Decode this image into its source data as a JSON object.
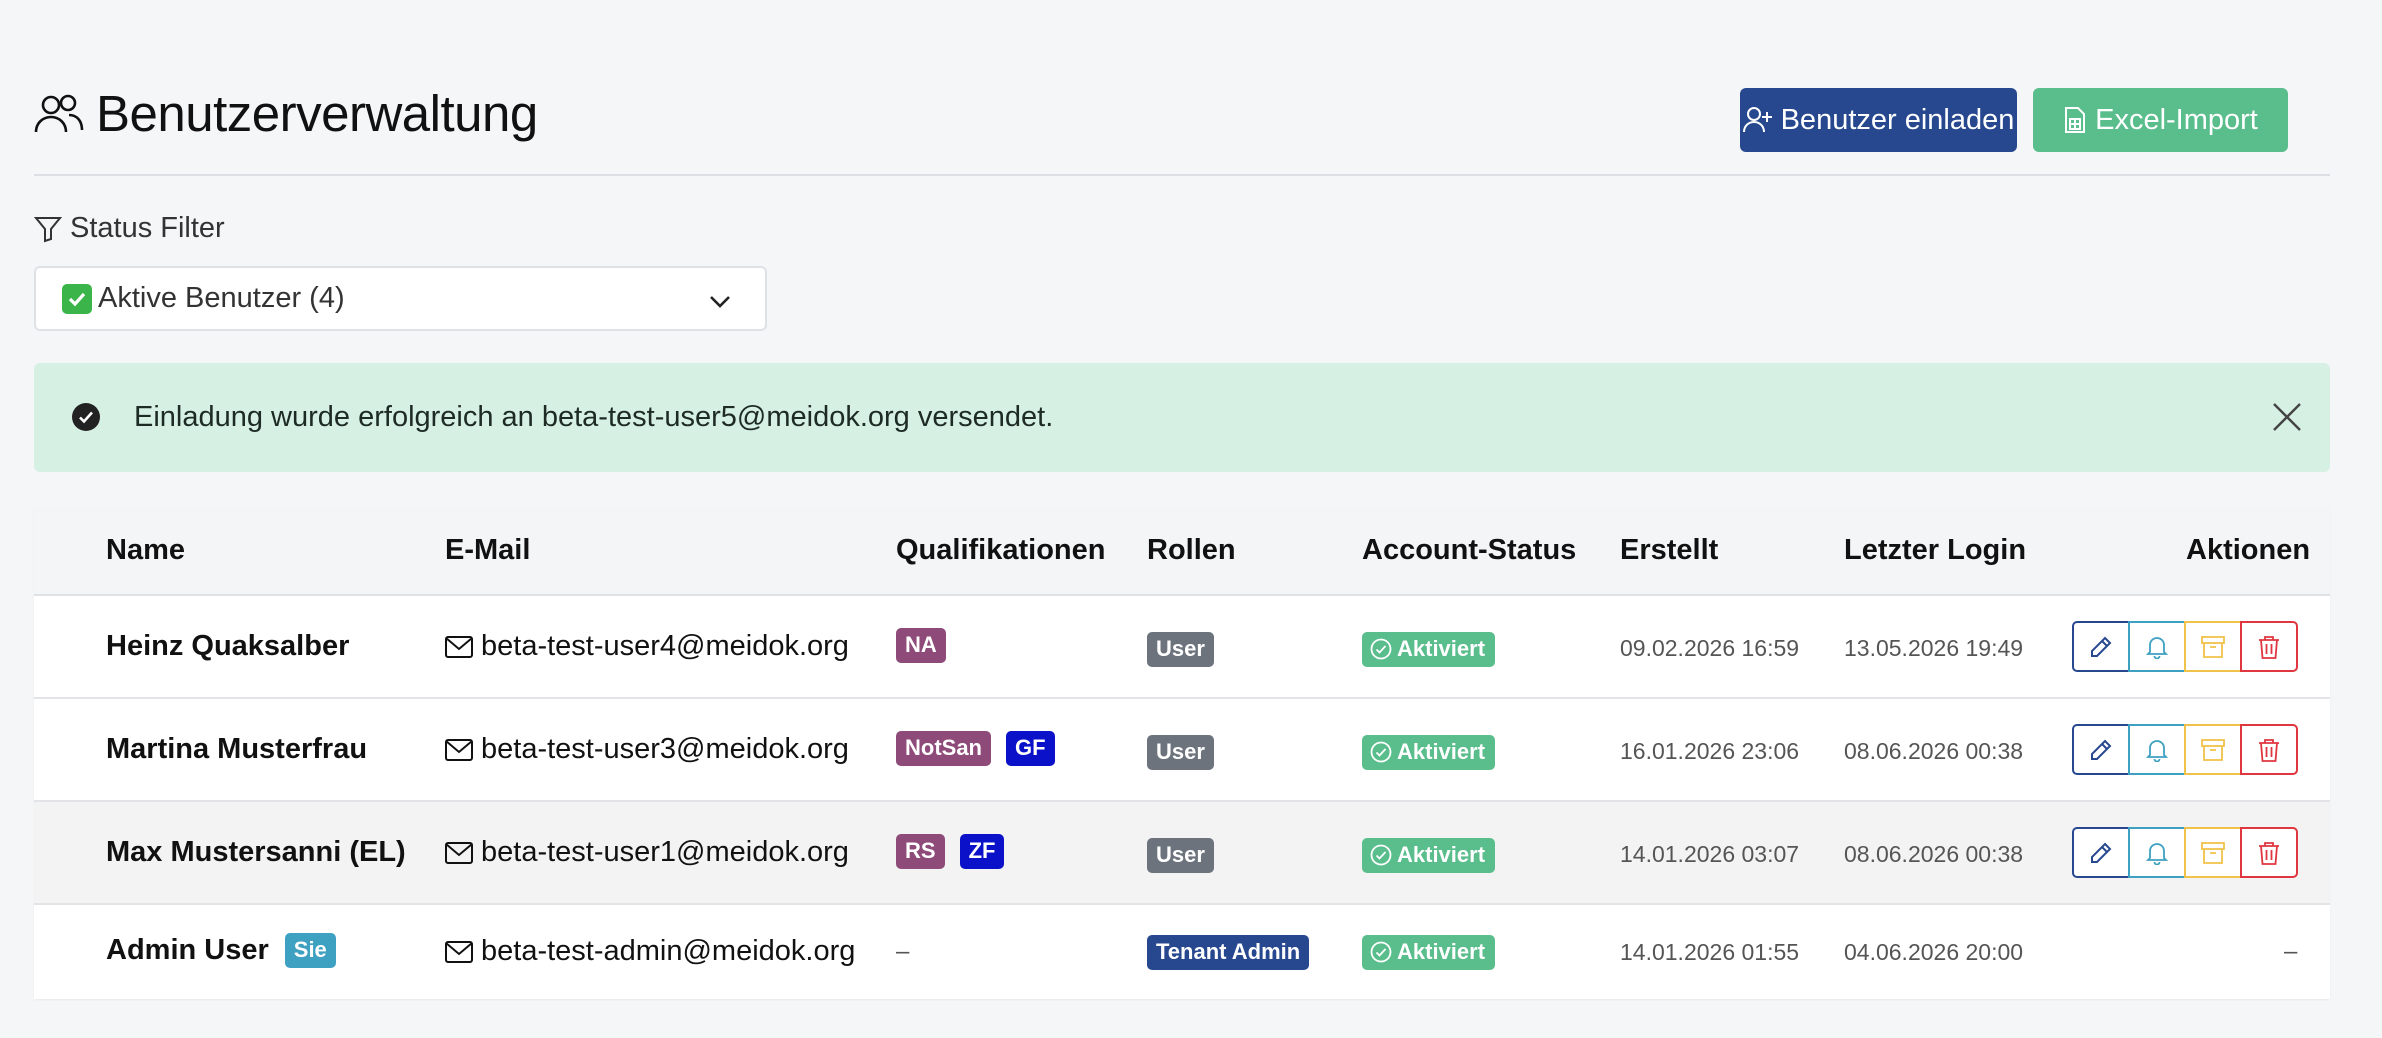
{
  "header": {
    "title": "Benutzerverwaltung",
    "invite_label": "Benutzer einladen",
    "import_label": "Excel-Import"
  },
  "filter": {
    "label": "Status Filter",
    "selected": "Aktive Benutzer (4)"
  },
  "alert": {
    "message": "Einladung wurde erfolgreich an beta-test-user5@meidok.org versendet."
  },
  "table": {
    "columns": [
      "Name",
      "E-Mail",
      "Qualifikationen",
      "Rollen",
      "Account-Status",
      "Erstellt",
      "Letzter Login",
      "Aktionen"
    ],
    "rows": [
      {
        "name": "Heinz Quaksalber",
        "email": "beta-test-user4@meidok.org",
        "quals": [
          "NA"
        ],
        "role": "User",
        "status": "Aktiviert",
        "created": "09.02.2026 16:59",
        "last_login": "13.05.2026 19:49"
      },
      {
        "name": "Martina Musterfrau",
        "email": "beta-test-user3@meidok.org",
        "quals": [
          "NotSan",
          "GF"
        ],
        "role": "User",
        "status": "Aktiviert",
        "created": "16.01.2026 23:06",
        "last_login": "08.06.2026 00:38"
      },
      {
        "name": "Max Mustersanni (EL)",
        "email": "beta-test-user1@meidok.org",
        "quals": [
          "RS",
          "ZF"
        ],
        "role": "User",
        "status": "Aktiviert",
        "created": "14.01.2026 03:07",
        "last_login": "08.06.2026 00:38"
      },
      {
        "name": "Admin User",
        "self_badge": "Sie",
        "email": "beta-test-admin@meidok.org",
        "quals_empty": "–",
        "role": "Tenant Admin",
        "status": "Aktiviert",
        "created": "14.01.2026 01:55",
        "last_login": "04.06.2026 20:00",
        "actions_empty": "–"
      }
    ]
  },
  "colors": {
    "primary": "#27488f",
    "success": "#59bd8c",
    "info": "#3ea1c1",
    "warning": "#f1c24a",
    "danger": "#e0363f",
    "qual_purple": "#8e4a78",
    "qual_blue": "#0b11c9",
    "alert_bg": "#d6f0e4"
  },
  "icons": {
    "title": "users-icon",
    "invite": "user-plus-icon",
    "import": "spreadsheet-file-icon",
    "filter": "funnel-icon",
    "select_check": "check-box-icon",
    "select_chevron": "chevron-down-icon",
    "alert": "check-circle-icon",
    "close": "close-icon",
    "email": "envelope-icon",
    "status": "check-circle-outline-icon",
    "edit": "pencil-icon",
    "notify": "bell-icon",
    "archive": "archive-box-icon",
    "delete": "trash-icon"
  }
}
